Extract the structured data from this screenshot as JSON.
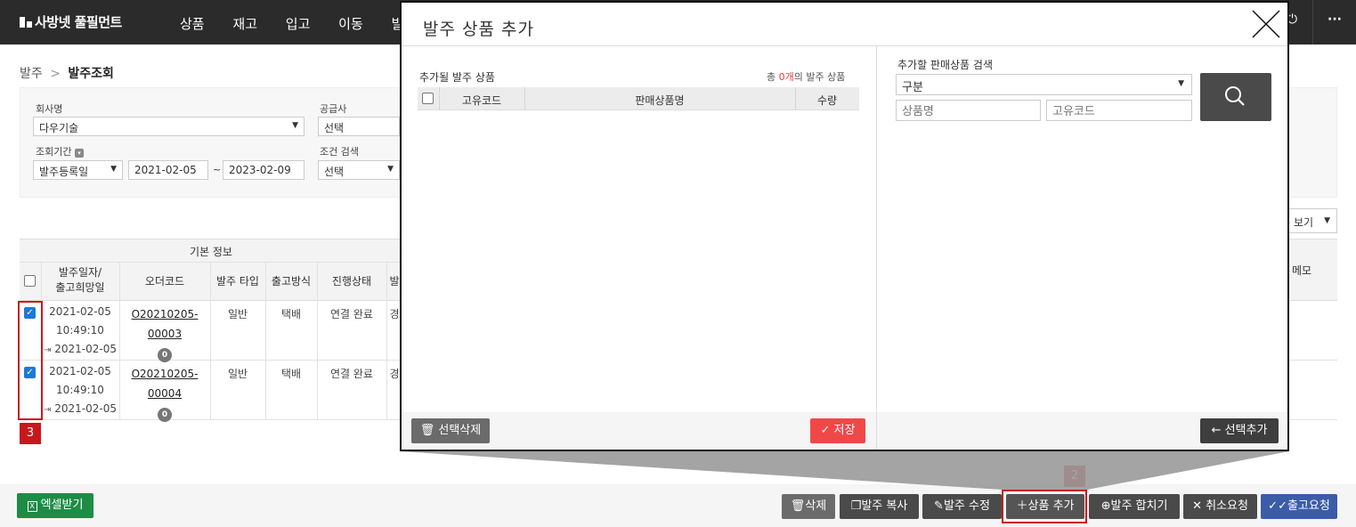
{
  "brand": {
    "name": "사방넷 풀필먼트"
  },
  "nav": [
    "상품",
    "재고",
    "입고",
    "이동",
    "발"
  ],
  "top_icons": {
    "power": "⏻",
    "more": "···"
  },
  "breadcrumb": {
    "root": "발주",
    "separator": ">",
    "current": "발주조회"
  },
  "filters": {
    "company_label": "회사명",
    "company_value": "다우기술",
    "supplier_label": "공급사",
    "supplier_value": "선택",
    "period_label": "조회기간",
    "period_type": "발주등록일",
    "date_from": "2021-02-05",
    "date_sep": "~",
    "date_to": "2023-02-09",
    "condition_label": "조건 검색",
    "condition_value": "선택"
  },
  "view_select": "보기",
  "grid": {
    "group_header": "기본 정보",
    "columns": [
      "발주일자/\n출고희망일",
      "오더코드",
      "발주 타입",
      "출고방식",
      "진행상태",
      "발"
    ],
    "right_column": "메모",
    "rows": [
      {
        "date": "2021-02-05",
        "time": "10:49:10",
        "due": "2021-02-05",
        "order_code": "O20210205-00003",
        "memo_count": "0",
        "type": "일반",
        "ship": "택배",
        "status": "연결 완료",
        "cut": "경"
      },
      {
        "date": "2021-02-05",
        "time": "10:49:10",
        "due": "2021-02-05",
        "order_code": "O20210205-00004",
        "memo_count": "0",
        "type": "일반",
        "ship": "택배",
        "status": "연결 완료",
        "cut": "경"
      }
    ]
  },
  "markers": {
    "rows": "3",
    "add_button": "2"
  },
  "bottom_buttons": {
    "excel": "엑셀받기",
    "delete": "삭제",
    "copy": "발주 복사",
    "edit": "발주 수정",
    "add_product": "상품 추가",
    "merge": "발주 합치기",
    "cancel": "취소요청",
    "release": "출고요청"
  },
  "modal": {
    "title": "발주 상품 추가",
    "left": {
      "heading": "추가될 발주 상품",
      "count_prefix": "총 ",
      "count": "0개",
      "count_suffix": "의 발주 상품",
      "columns": [
        "고유코드",
        "판매상품명",
        "수량"
      ],
      "delete_button": "선택삭제",
      "save_button": "저장"
    },
    "right": {
      "heading": "추가할 판매상품 검색",
      "category_value": "구분",
      "name_placeholder": "상품명",
      "code_placeholder": "고유코드",
      "add_button": "선택추가"
    }
  },
  "colors": {
    "accent_red": "#c9181c",
    "save_red": "#f04848",
    "check_blue": "#1e78d8",
    "release_blue": "#3b5da8",
    "excel_green": "#1d8c45",
    "count_red": "#e23b3b"
  }
}
